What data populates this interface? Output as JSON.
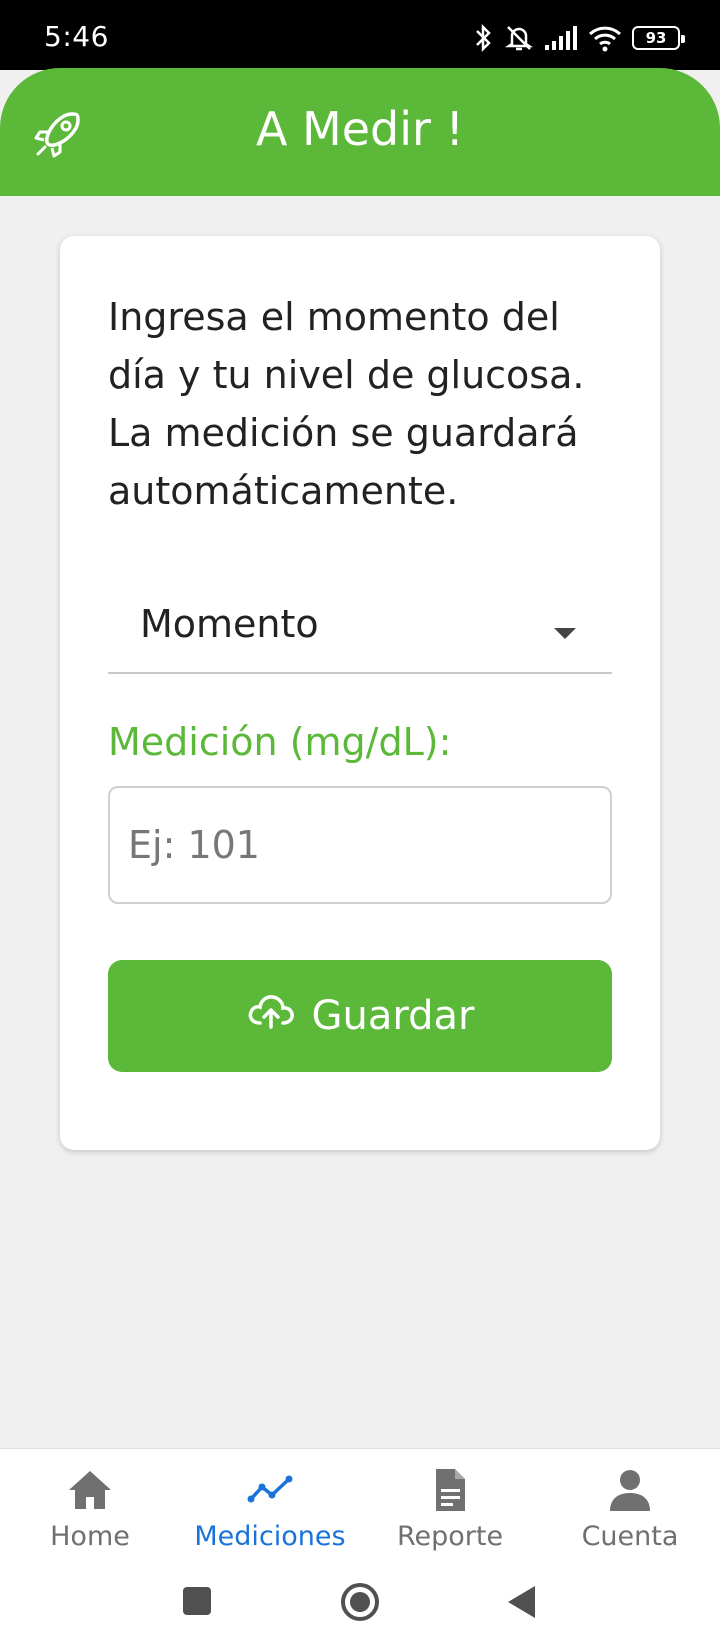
{
  "status_bar": {
    "time": "5:46",
    "battery": "93"
  },
  "header": {
    "title": "A Medir !",
    "icon": "rocket-icon"
  },
  "form": {
    "description": "Ingresa el momento del día y tu nivel de glucosa. La medición se guardará automáticamente.",
    "moment_select": {
      "value": "Momento"
    },
    "measurement_label": "Medición (mg/dL):",
    "measurement_input": {
      "value": "",
      "placeholder": "Ej: 101"
    },
    "save_button": {
      "label": "Guardar",
      "icon": "cloud-upload-icon"
    }
  },
  "bottom_nav": {
    "items": [
      {
        "label": "Home",
        "icon": "home-icon",
        "active": false
      },
      {
        "label": "Mediciones",
        "icon": "chart-line-icon",
        "active": true
      },
      {
        "label": "Reporte",
        "icon": "document-icon",
        "active": false
      },
      {
        "label": "Cuenta",
        "icon": "person-icon",
        "active": false
      }
    ]
  },
  "colors": {
    "primary": "#5bb838",
    "active_nav": "#1a73d9",
    "background": "#f0f0f0"
  }
}
